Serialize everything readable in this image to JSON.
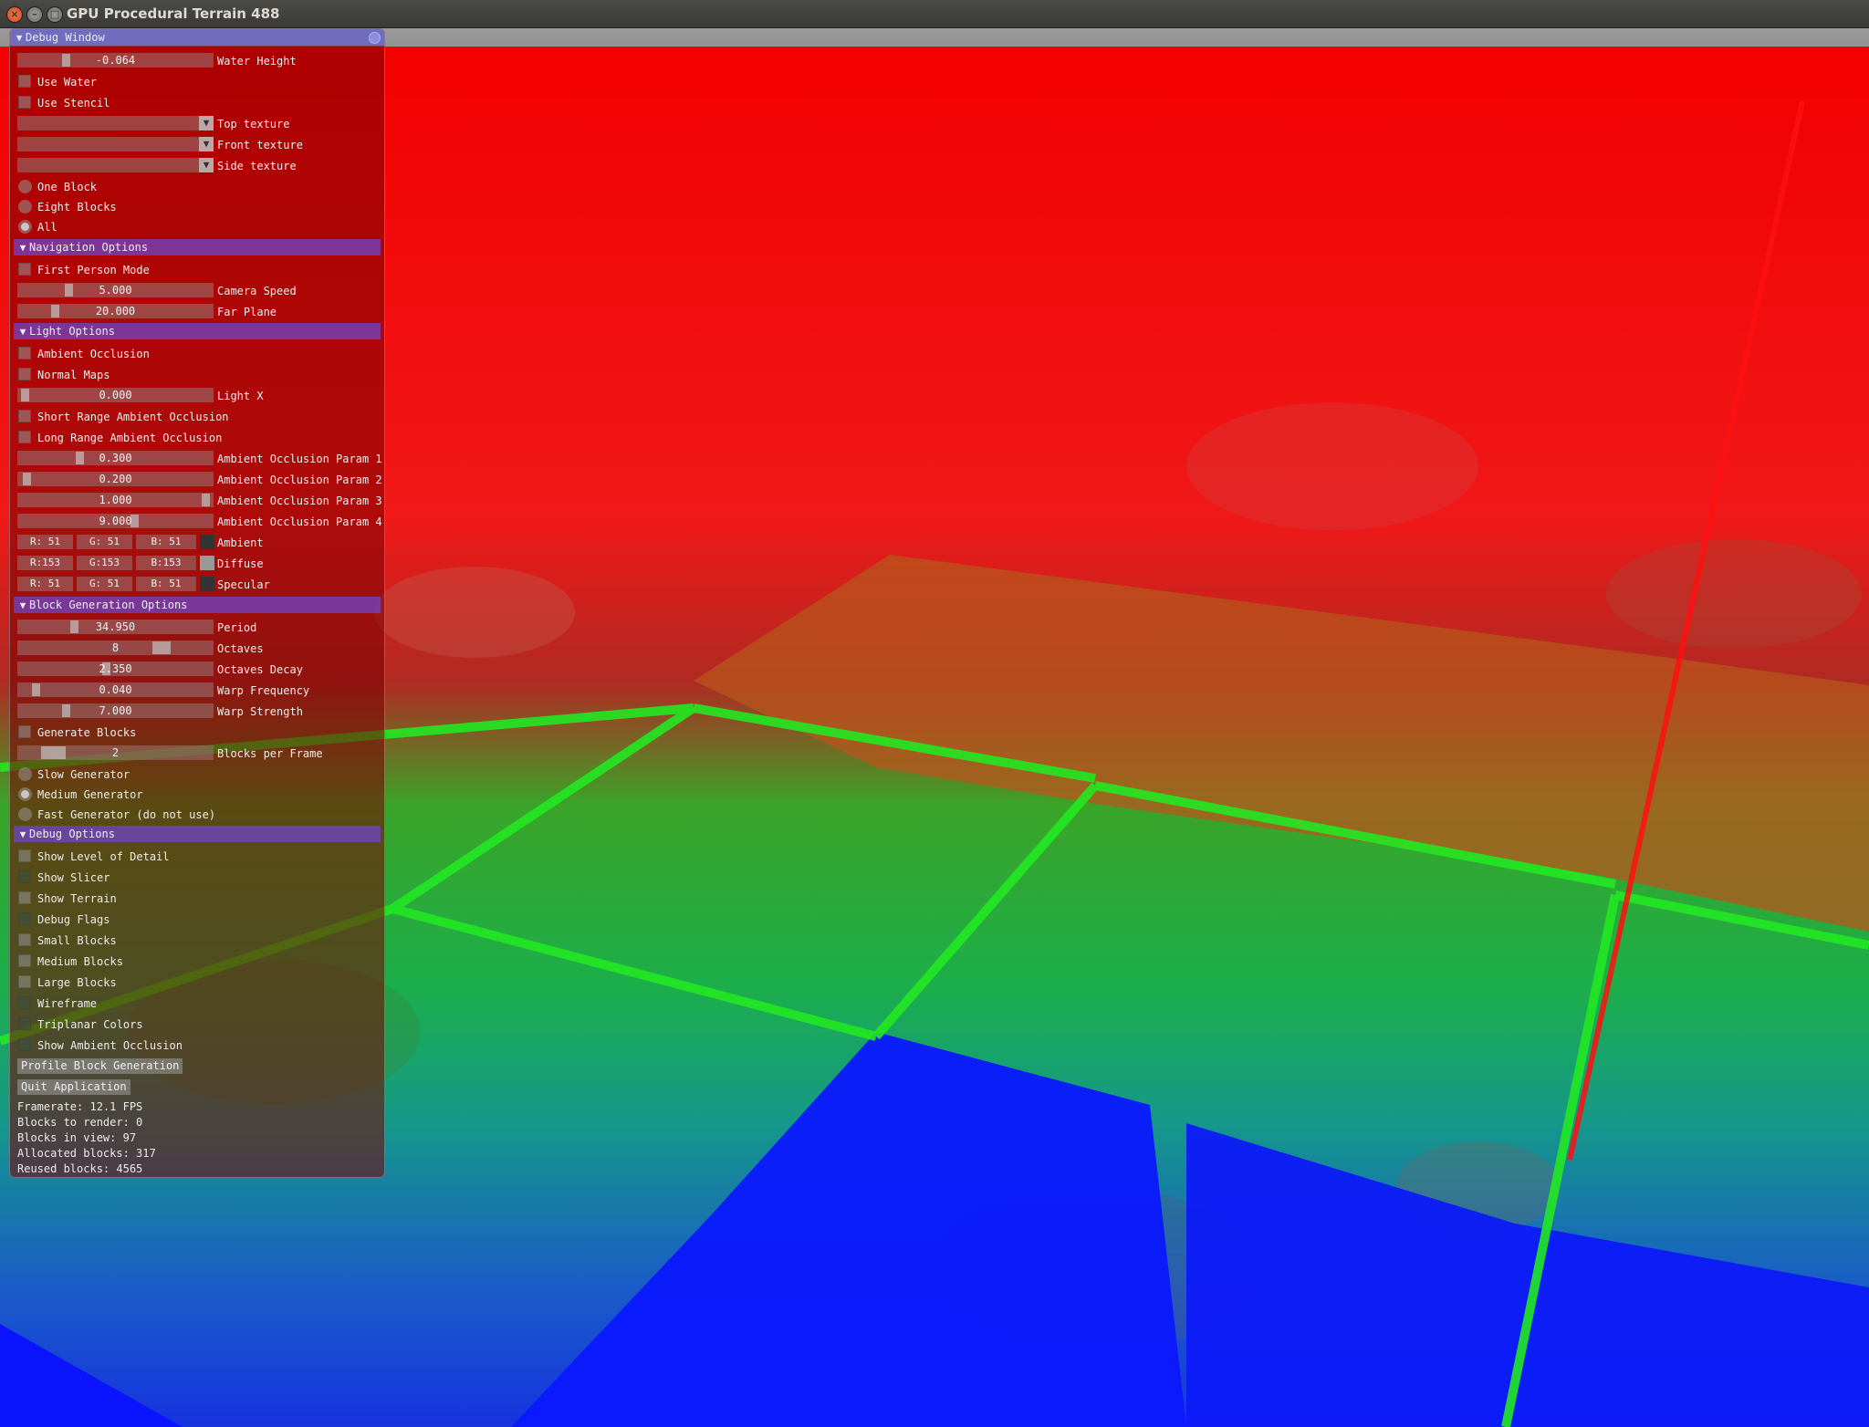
{
  "window": {
    "title": "GPU Procedural Terrain 488"
  },
  "debug_window": {
    "title": "Debug Window",
    "water_height": {
      "value": "-0.064",
      "label": "Water Height",
      "level": 0.24
    },
    "use_water": "Use Water",
    "use_stencil": "Use Stencil",
    "top_texture": "Top texture",
    "front_texture": "Front texture",
    "side_texture": "Side texture",
    "block_mode": {
      "one": "One Block",
      "eight": "Eight Blocks",
      "all": "All",
      "selected": "All"
    },
    "navigation": {
      "title": "Navigation Options",
      "first_person": "First Person Mode",
      "camera_speed": {
        "value": "5.000",
        "label": "Camera Speed",
        "level": 0.25
      },
      "far_plane": {
        "value": "20.000",
        "label": "Far Plane",
        "level": 0.18
      }
    },
    "light": {
      "title": "Light Options",
      "ambient_occlusion": "Ambient Occlusion",
      "normal_maps": "Normal Maps",
      "light_x": {
        "value": "0.000",
        "label": "Light X",
        "level": 0.02
      },
      "short_range_ao": "Short Range Ambient Occlusion",
      "long_range_ao": "Long Range Ambient Occlusion",
      "ao_params": [
        {
          "value": "0.300",
          "label": "Ambient Occlusion Param 1",
          "level": 0.31
        },
        {
          "value": "0.200",
          "label": "Ambient Occlusion Param 2",
          "level": 0.03
        },
        {
          "value": "1.000",
          "label": "Ambient Occlusion Param 3",
          "level": 0.98
        },
        {
          "value": "9.000",
          "label": "Ambient Occlusion Param 4",
          "level": 0.6
        }
      ],
      "ambient": {
        "r": "R: 51",
        "g": "G: 51",
        "b": "B: 51",
        "label": "Ambient",
        "color": "#333333"
      },
      "diffuse": {
        "r": "R:153",
        "g": "G:153",
        "b": "B:153",
        "label": "Diffuse",
        "color": "#999999"
      },
      "specular": {
        "r": "R: 51",
        "g": "G: 51",
        "b": "B: 51",
        "label": "Specular",
        "color": "#333333"
      }
    },
    "block_generation": {
      "title": "Block Generation Options",
      "period": {
        "value": "34.950",
        "label": "Period",
        "level": 0.28
      },
      "octaves": {
        "value": "8",
        "label": "Octaves",
        "level": 0.76
      },
      "octaves_decay": {
        "value": "2.350",
        "label": "Octaves Decay",
        "level": 0.45
      },
      "warp_frequency": {
        "value": "0.040",
        "label": "Warp Frequency",
        "level": 0.08
      },
      "warp_strength": {
        "value": "7.000",
        "label": "Warp Strength",
        "level": 0.24
      },
      "generate_blocks": "Generate Blocks",
      "blocks_per_frame": {
        "value": "2",
        "label": "Blocks per Frame",
        "level": 0.14
      },
      "slow": "Slow Generator",
      "medium": "Medium Generator",
      "fast": "Fast Generator (do not use)",
      "selected": "Medium Generator"
    },
    "debug": {
      "title": "Debug Options",
      "items": [
        "Show Level of Detail",
        "Show Slicer",
        "Show Terrain",
        "Debug Flags",
        "Small Blocks",
        "Medium Blocks",
        "Large Blocks",
        "Wireframe",
        "Triplanar Colors",
        "Show Ambient Occlusion"
      ],
      "profile_button": "Profile Block Generation",
      "quit_button": "Quit Application"
    },
    "stats": {
      "framerate": "Framerate: 12.1 FPS",
      "to_render": "Blocks to render: 0",
      "in_view": "Blocks in view: 97",
      "allocated": "Allocated blocks: 317",
      "reused": "Reused blocks: 4565"
    }
  },
  "colors": {
    "red_layer": "#ff0000",
    "green_layer": "#1fc21f",
    "blue_layer": "#0a14ff",
    "grid_lines": "#22e822"
  }
}
